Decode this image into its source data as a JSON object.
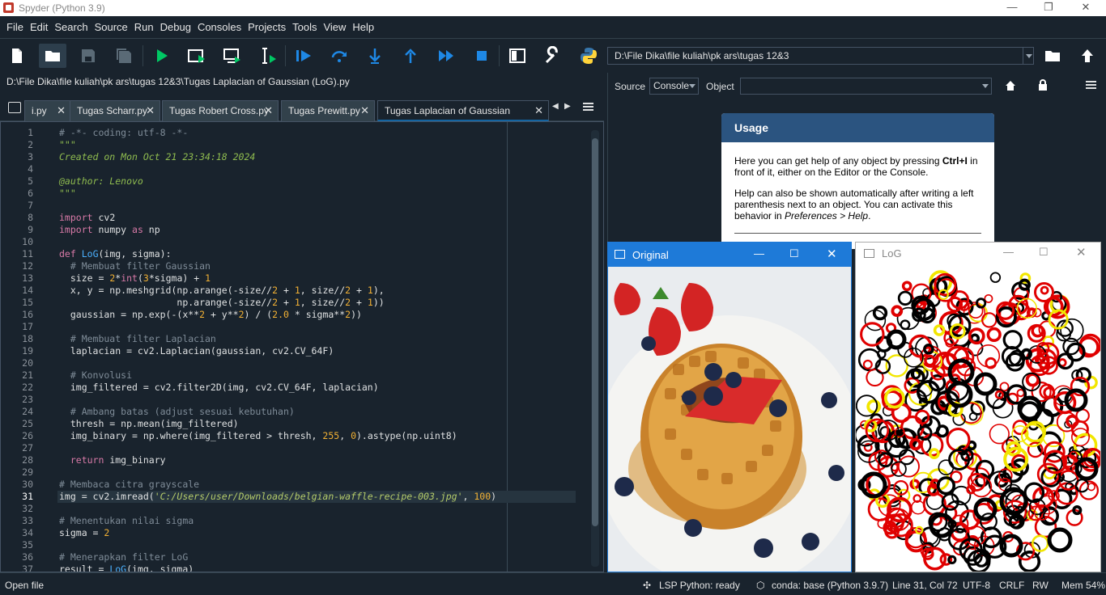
{
  "window": {
    "title": "Spyder (Python 3.9)"
  },
  "menu": [
    "File",
    "Edit",
    "Search",
    "Source",
    "Run",
    "Debug",
    "Consoles",
    "Projects",
    "Tools",
    "View",
    "Help"
  ],
  "toolbar": {
    "icons": [
      "new-file",
      "open-file",
      "save",
      "save-all",
      "run",
      "run-cell",
      "run-cell-advance",
      "run-selection",
      "debug",
      "step-over",
      "step-into",
      "step-return",
      "continue",
      "stop",
      "maximize-pane",
      "preferences",
      "python-path"
    ],
    "working_dir": "D:\\File Dika\\file kuliah\\pk ars\\tugas 12&3"
  },
  "editor": {
    "file_path": "D:\\File Dika\\file kuliah\\pk ars\\tugas 12&3\\Tugas Laplacian of Gaussian (LoG).py",
    "tabs": [
      {
        "label": "i.py",
        "active": false
      },
      {
        "label": "Tugas Scharr.py",
        "active": false
      },
      {
        "label": "Tugas Robert Cross.py",
        "active": false
      },
      {
        "label": "Tugas Prewitt.py",
        "active": false
      },
      {
        "label": "Tugas Laplacian of Gaussian (LoG).py",
        "active": true
      }
    ],
    "current_line": 31,
    "lines": [
      "# -*- coding: utf-8 -*-",
      "\"\"\"",
      "Created on Mon Oct 21 23:34:18 2024",
      "",
      "@author: Lenovo",
      "\"\"\"",
      "",
      "import cv2",
      "import numpy as np",
      "",
      "def LoG(img, sigma):",
      "  # Membuat filter Gaussian",
      "  size = 2*int(3*sigma) + 1",
      "  x, y = np.meshgrid(np.arange(-size//2 + 1, size//2 + 1),",
      "                     np.arange(-size//2 + 1, size//2 + 1))",
      "  gaussian = np.exp(-(x**2 + y**2) / (2.0 * sigma**2))",
      "",
      "  # Membuat filter Laplacian",
      "  laplacian = cv2.Laplacian(gaussian, cv2.CV_64F)",
      "",
      "  # Konvolusi",
      "  img_filtered = cv2.filter2D(img, cv2.CV_64F, laplacian)",
      "",
      "  # Ambang batas (adjust sesuai kebutuhan)",
      "  thresh = np.mean(img_filtered)",
      "  img_binary = np.where(img_filtered > thresh, 255, 0).astype(np.uint8)",
      "",
      "  return img_binary",
      "",
      "# Membaca citra grayscale",
      "img = cv2.imread('C:/Users/user/Downloads/belgian-waffle-recipe-003.jpg', 100)",
      "",
      "# Menentukan nilai sigma",
      "sigma = 2",
      "",
      "# Menerapkan filter LoG",
      "result = LoG(img, sigma)"
    ]
  },
  "help": {
    "source_label": "Source",
    "source_value": "Console",
    "object_label": "Object",
    "object_value": "",
    "usage_title": "Usage",
    "usage_p1_a": "Here you can get help of any object by pressing ",
    "usage_p1_key": "Ctrl+I",
    "usage_p1_b": " in front of it, either on the Editor or the Console.",
    "usage_p2_a": "Help can also be shown automatically after writing a left parenthesis next to an object. You can activate this behavior in ",
    "usage_p2_em": "Preferences > Help",
    "usage_p2_b": "."
  },
  "image_windows": [
    {
      "title": "Original",
      "content": "waffle photo"
    },
    {
      "title": "LoG",
      "content": "binary edge map"
    }
  ],
  "status": {
    "left": "Open file",
    "lsp": "LSP Python: ready",
    "conda": "conda: base (Python 3.9.7)",
    "position": "Line 31, Col 72",
    "encoding": "UTF-8",
    "eol": "CRLF",
    "mode": "RW",
    "mem": "Mem 54%"
  }
}
